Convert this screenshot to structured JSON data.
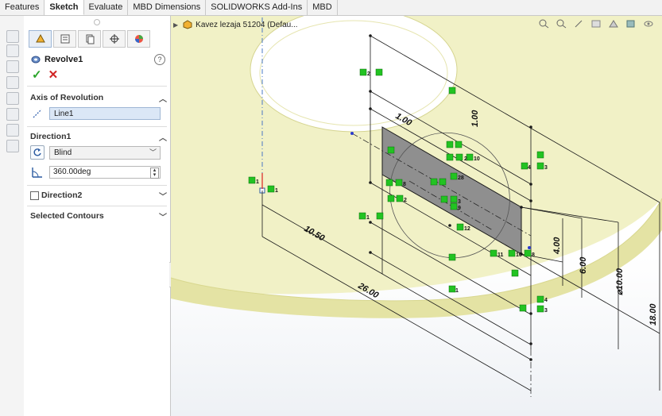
{
  "command_tabs": [
    {
      "label": "Features",
      "active": false
    },
    {
      "label": "Sketch",
      "active": true
    },
    {
      "label": "Evaluate",
      "active": false
    },
    {
      "label": "MBD Dimensions",
      "active": false
    },
    {
      "label": "SOLIDWORKS Add-Ins",
      "active": false
    },
    {
      "label": "MBD",
      "active": false
    }
  ],
  "property_manager": {
    "title": "Revolve1",
    "help_symbol": "?",
    "ok_symbol": "✓",
    "cancel_symbol": "✕",
    "axis_section": {
      "header": "Axis of Revolution",
      "value": "Line1"
    },
    "direction1_section": {
      "header": "Direction1",
      "end_condition": "Blind",
      "angle": "360.00deg"
    },
    "direction2_section": {
      "header": "Direction2",
      "checked": false
    },
    "contours_section": {
      "header": "Selected Contours"
    }
  },
  "feature_tree": {
    "part_name": "Kavez lezaja 51204  (Defau..."
  },
  "dimensions": [
    "1.00",
    "1.00",
    "10.50",
    "26.00",
    "4.00",
    "6.00",
    "⌀10.00",
    "18.00"
  ],
  "relation_labels": [
    "2",
    "1",
    "3",
    "1",
    "3",
    "4",
    "2",
    "28",
    "9",
    "8",
    "2",
    "10",
    "12",
    "11",
    "10",
    "8",
    "1",
    "1",
    "4",
    "3"
  ],
  "colors": {
    "accent": "#9db6d6",
    "part_yellow": "#f1f1c4",
    "relation_green": "#22c322",
    "sketch_black": "#1a1a1a",
    "profile_gray": "#8f8f8f"
  }
}
